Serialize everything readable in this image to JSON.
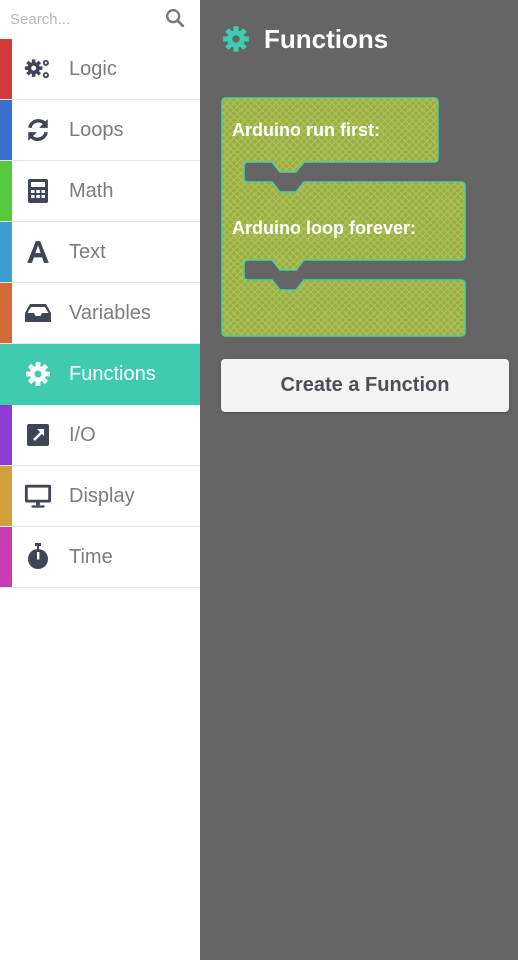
{
  "search": {
    "placeholder": "Search..."
  },
  "categories": [
    {
      "label": "Logic",
      "icon": "gears-icon",
      "color": "#d43a3a"
    },
    {
      "label": "Loops",
      "icon": "refresh-icon",
      "color": "#3b6fd1"
    },
    {
      "label": "Math",
      "icon": "calculator-icon",
      "color": "#54c93a"
    },
    {
      "label": "Text",
      "icon": "text-icon",
      "color": "#3a9ed1"
    },
    {
      "label": "Variables",
      "icon": "inbox-icon",
      "color": "#d46a3a"
    },
    {
      "label": "Functions",
      "icon": "gear-icon",
      "color": "#3ecbb0",
      "active": true
    },
    {
      "label": "I/O",
      "icon": "external-link-icon",
      "color": "#8e3ad1"
    },
    {
      "label": "Display",
      "icon": "monitor-icon",
      "color": "#d1a03a"
    },
    {
      "label": "Time",
      "icon": "stopwatch-icon",
      "color": "#c93ab5"
    }
  ],
  "flyout": {
    "title": "Functions",
    "block": {
      "run_first_label": "Arduino run first:",
      "loop_forever_label": "Arduino loop forever:",
      "fill_color": "#a8a846",
      "border_color": "#4ad09e"
    },
    "create_button_label": "Create a Function"
  },
  "colors": {
    "accent": "#3ecbb0",
    "flyout_bg": "#656565",
    "icon_dark": "#3d4557"
  }
}
